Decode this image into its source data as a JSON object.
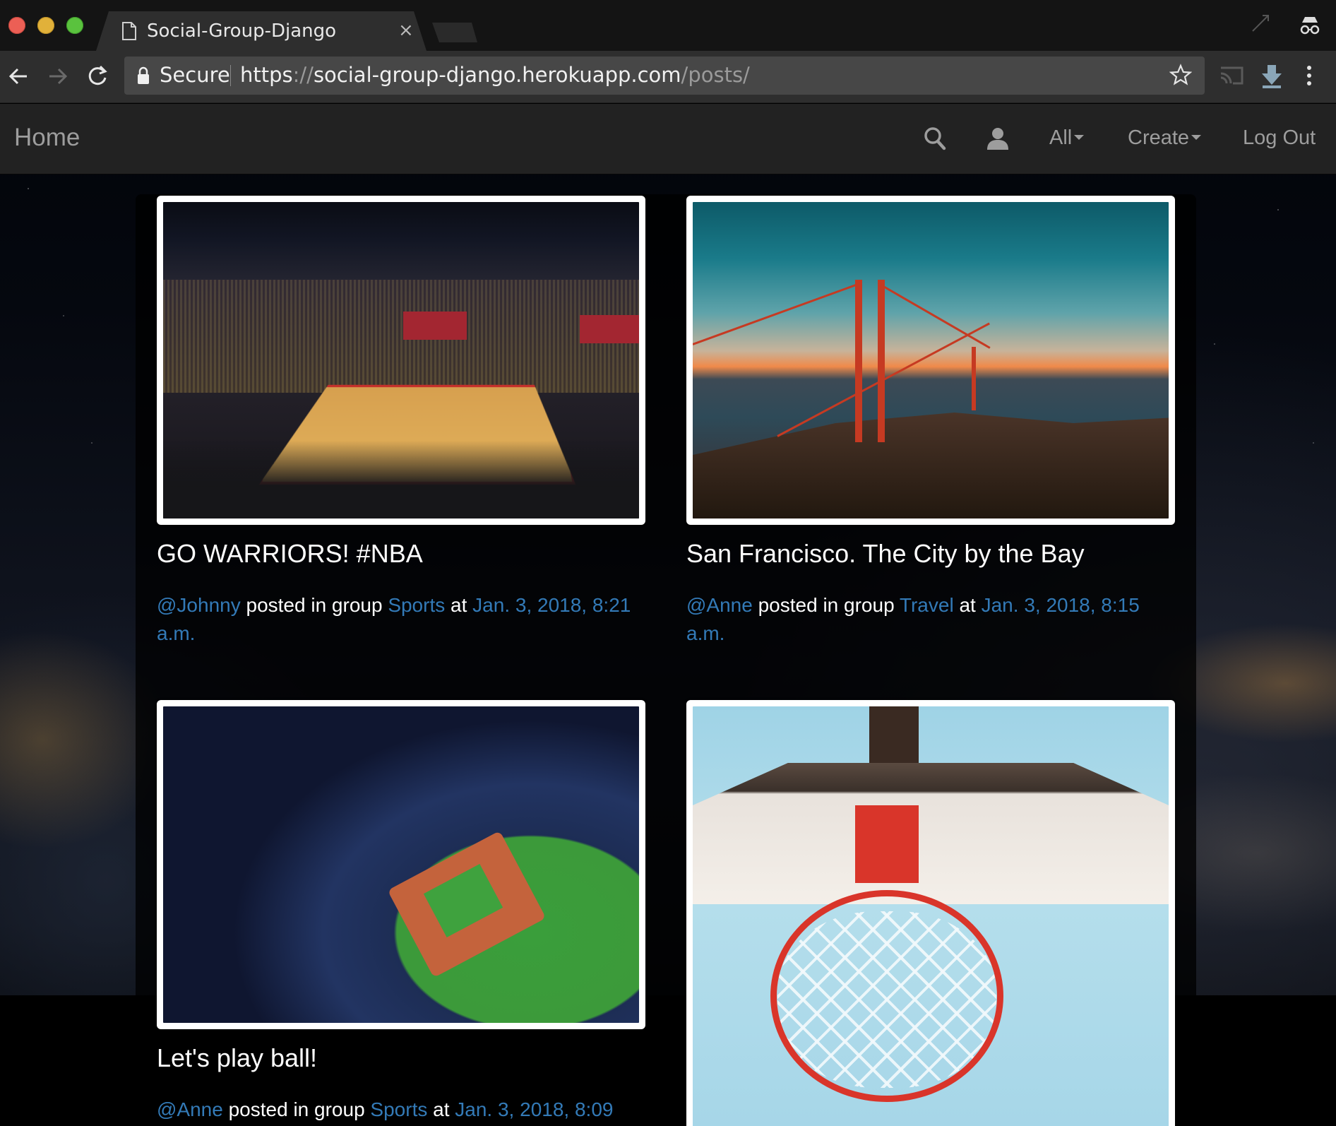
{
  "browser": {
    "tab_title": "Social-Group-Django",
    "tab_close": "×",
    "secure_label": "Secure",
    "url": {
      "scheme": "https",
      "sep": "://",
      "host": "social-group-django.herokuapp.com",
      "path": "/posts/"
    }
  },
  "navbar": {
    "brand": "Home",
    "all_label": "All",
    "create_label": "Create",
    "logout_label": "Log Out"
  },
  "posts": [
    {
      "title": "GO WARRIORS! #NBA",
      "user": "@Johnny",
      "posted_in": " posted in group ",
      "group": "Sports",
      "at": " at ",
      "date": "Jan. 3, 2018, 8:21 a.m."
    },
    {
      "title": "San Francisco. The City by the Bay",
      "user": "@Anne",
      "posted_in": " posted in group ",
      "group": "Travel",
      "at": " at ",
      "date": "Jan. 3, 2018, 8:15 a.m."
    },
    {
      "title": "Let's play ball!",
      "user": "@Anne",
      "posted_in": " posted in group ",
      "group": "Sports",
      "at": " at ",
      "date": "Jan. 3, 2018, 8:09"
    }
  ],
  "colors": {
    "link": "#337ab7",
    "navbar_bg": "#222222",
    "navbar_text": "#9d9d9d"
  }
}
